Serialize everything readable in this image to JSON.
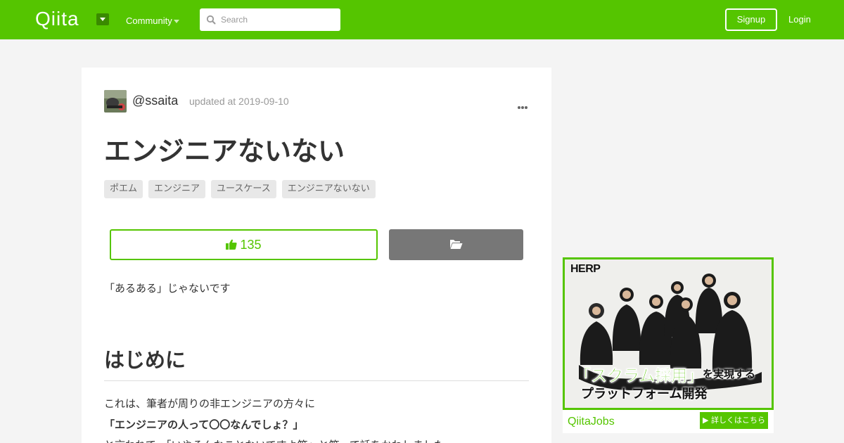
{
  "header": {
    "logo": "Qiita",
    "community_label": "Community",
    "search_placeholder": "Search",
    "signup_label": "Signup",
    "login_label": "Login",
    "brand_color": "#55c500"
  },
  "article": {
    "author": "@ssaita",
    "updated": "updated at 2019-09-10",
    "title": "エンジニアないない",
    "tags": [
      "ポエム",
      "エンジニア",
      "ユースケース",
      "エンジニアないない"
    ],
    "like_count": "135",
    "lead": "「あるある」じゃないです",
    "heading": "はじめに",
    "paragraph1": "これは、筆者が周りの非エンジニアの方々に",
    "paragraph2": "「エンジニアの人って〇〇なんでしょ？」",
    "paragraph3": "と言われて、「いやそんなことないですよ笑」と笑って話をかわしました"
  },
  "ad": {
    "brand": "HERP",
    "headline": "「スクラム採用」",
    "headline_suffix": "を実現する",
    "subheadline": "プラットフォーム開発",
    "logo": "QiitaJobs",
    "cta": "▶ 詳しくはこちら"
  },
  "icons": {
    "search": "search-icon",
    "like": "thumbs-up-icon",
    "stock": "folder-open-icon",
    "more": "more-icon",
    "dropdown": "caret-down-icon"
  }
}
